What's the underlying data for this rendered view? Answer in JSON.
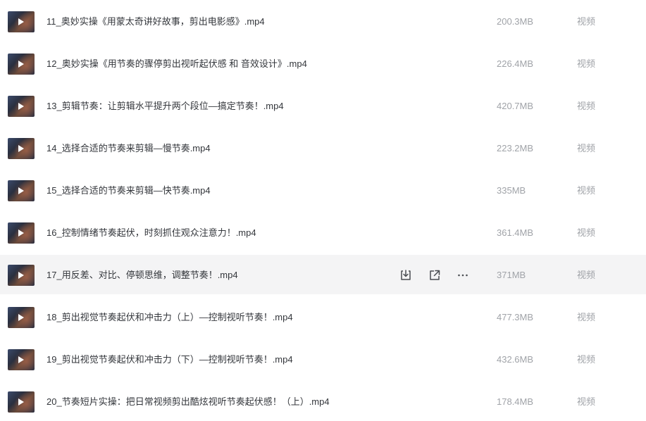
{
  "files": [
    {
      "name": "11_奥妙实操《用蒙太奇讲好故事，剪出电影感》.mp4",
      "size": "200.3MB",
      "type": "视频"
    },
    {
      "name": "12_奥妙实操《用节奏的骤停剪出视听起伏感 和 音效设计》.mp4",
      "size": "226.4MB",
      "type": "视频"
    },
    {
      "name": "13_剪辑节奏：让剪辑水平提升两个段位—搞定节奏！.mp4",
      "size": "420.7MB",
      "type": "视频"
    },
    {
      "name": "14_选择合适的节奏来剪辑—慢节奏.mp4",
      "size": "223.2MB",
      "type": "视频"
    },
    {
      "name": "15_选择合适的节奏来剪辑—快节奏.mp4",
      "size": "335MB",
      "type": "视频"
    },
    {
      "name": "16_控制情绪节奏起伏，时刻抓住观众注意力！.mp4",
      "size": "361.4MB",
      "type": "视频"
    },
    {
      "name": "17_用反差、对比、停顿思维，调整节奏！.mp4",
      "size": "371MB",
      "type": "视频",
      "hovered": true
    },
    {
      "name": "18_剪出视觉节奏起伏和冲击力（上）—控制视听节奏！.mp4",
      "size": "477.3MB",
      "type": "视频"
    },
    {
      "name": "19_剪出视觉节奏起伏和冲击力（下）—控制视听节奏！.mp4",
      "size": "432.6MB",
      "type": "视频"
    },
    {
      "name": "20_节奏短片实操：把日常视频剪出酷炫视听节奏起伏感！（上）.mp4",
      "size": "178.4MB",
      "type": "视频"
    }
  ],
  "row_actions": {
    "icons": [
      "download-icon",
      "share-icon",
      "more-icon"
    ]
  }
}
